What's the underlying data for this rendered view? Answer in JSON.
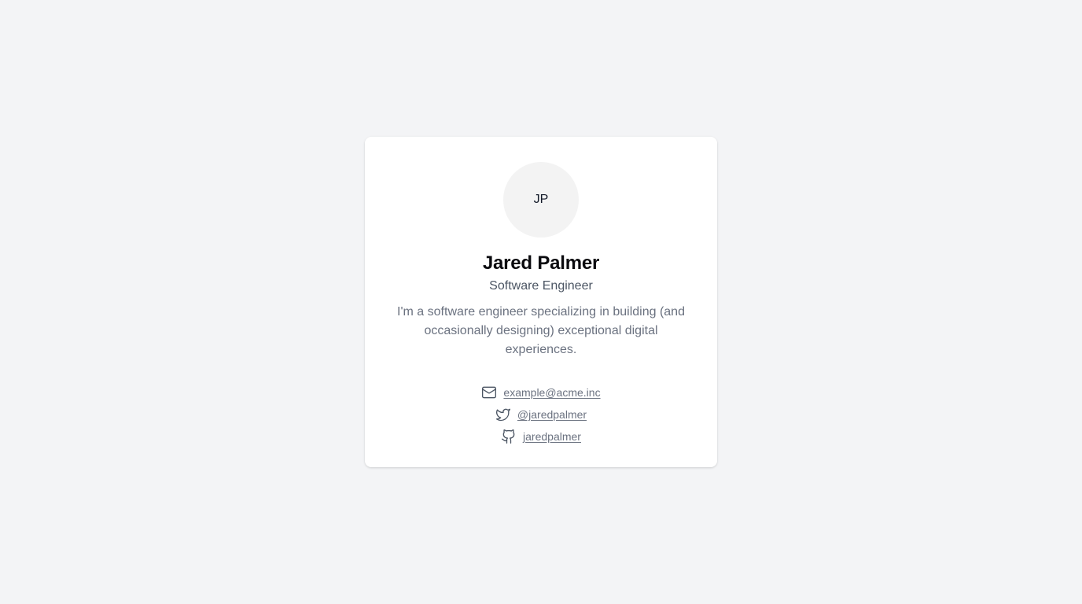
{
  "profile": {
    "initials": "JP",
    "name": "Jared Palmer",
    "role": "Software Engineer",
    "bio": "I'm a software engineer specializing in building (and occasionally designing) exceptional digital experiences."
  },
  "links": [
    {
      "icon": "mail-icon",
      "text": "example@acme.inc"
    },
    {
      "icon": "twitter-icon",
      "text": "@jaredpalmer"
    },
    {
      "icon": "github-icon",
      "text": "jaredpalmer"
    }
  ],
  "colors": {
    "background": "#f3f4f6",
    "card": "#ffffff",
    "avatar_bg": "#f3f3f3",
    "name": "#0b0b0f",
    "muted": "#6b7280"
  }
}
